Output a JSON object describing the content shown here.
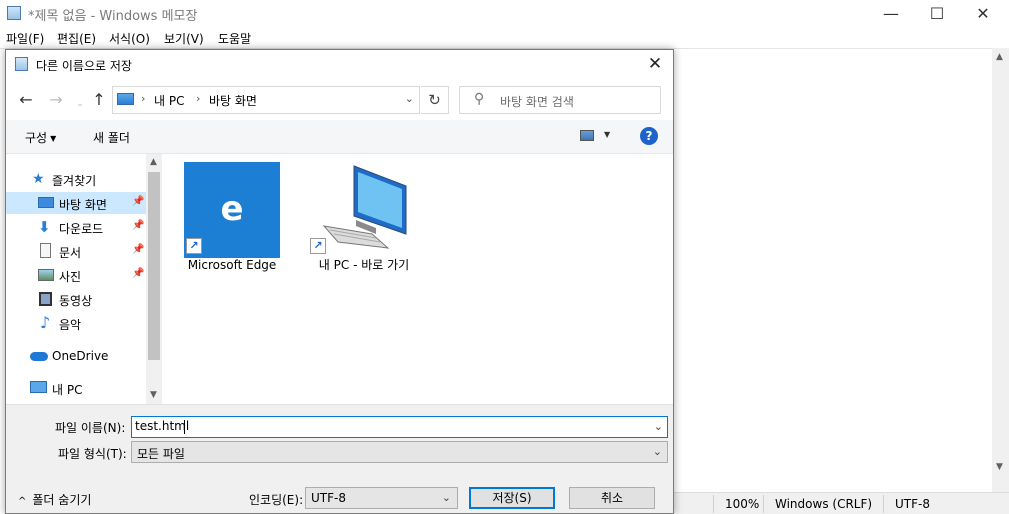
{
  "notepad": {
    "title": "*제목 없음 - Windows 메모장",
    "controls": {
      "minimize": "—",
      "maximize": "☐",
      "close": "✕"
    },
    "menu": [
      "파일(F)",
      "편집(E)",
      "서식(O)",
      "보기(V)",
      "도움말"
    ],
    "status": {
      "zoom": "100%",
      "line_ending": "Windows (CRLF)",
      "encoding": "UTF-8"
    }
  },
  "dialog": {
    "title": "다른 이름으로 저장",
    "close": "✕",
    "nav": {
      "back": "←",
      "forward": "→",
      "up": "↑",
      "refresh": "↻"
    },
    "address": {
      "crumbs": [
        "내 PC",
        "바탕 화면"
      ],
      "sep": "›"
    },
    "search": {
      "placeholder": "바탕 화면 검색"
    },
    "toolbar": {
      "organize": "구성",
      "new_folder": "새 폴더",
      "help": "?"
    },
    "navpane": {
      "quick_access": "즐겨찾기",
      "items": [
        "바탕 화면",
        "다운로드",
        "문서",
        "사진",
        "동영상",
        "음악"
      ],
      "onedrive": "OneDrive",
      "this_pc": "내 PC"
    },
    "files": [
      {
        "label": "Microsoft Edge",
        "icon": "edge-icon"
      },
      {
        "label": "내 PC - 바로 가기",
        "icon": "computer-icon"
      }
    ],
    "form": {
      "filename_label": "파일 이름(N):",
      "filename_value": "test.html",
      "filetype_label": "파일 형식(T):",
      "filetype_value": "모든 파일",
      "encoding_label": "인코딩(E):",
      "encoding_value": "UTF-8",
      "hide_folders": "폴더 숨기기",
      "save": "저장(S)",
      "cancel": "취소"
    },
    "colors": {
      "accent": "#0078d7",
      "selected_bg": "#cce8ff",
      "edge_blue": "#1d7fd4"
    }
  }
}
